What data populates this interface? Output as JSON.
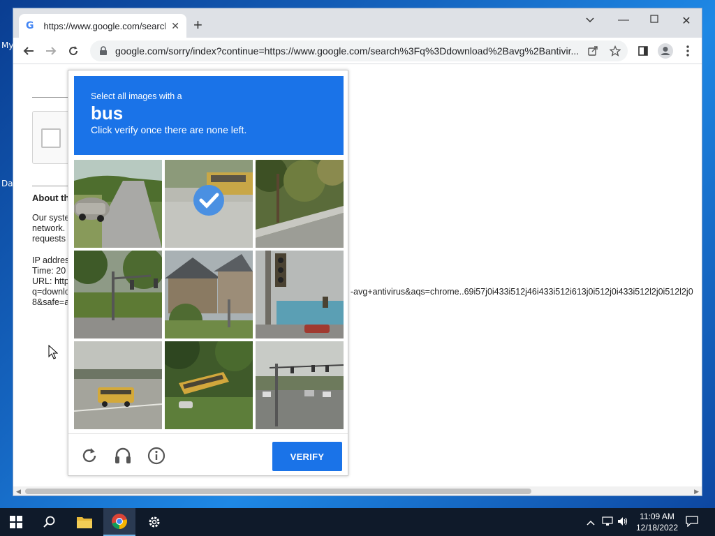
{
  "desktop": {
    "icon_labels": [
      "My",
      "Da"
    ]
  },
  "browser": {
    "tab_title": "https://www.google.com/search?q=download+avg+antivirus",
    "url": "google.com/sorry/index?continue=https://www.google.com/search%3Fq%3Ddownload%2Bavg%2Bantivir..."
  },
  "page": {
    "about_heading": "About th",
    "para_lines": [
      "Our syste",
      "network.",
      "requests"
    ],
    "ip_line": "IP addres",
    "time_line": "Time: 20",
    "url_line": "URL: http",
    "q_line": "q=downlo",
    "safe_line": "8&safe=a",
    "url_overflow": "-avg+antivirus&aqs=chrome..69i57j0i433i512j46i433i512i613j0i512j0i433i512l2j0i512l2j0"
  },
  "captcha": {
    "instruction": "Select all images with a",
    "target": "bus",
    "subtext": "Click verify once there are none left.",
    "verify_label": "VERIFY",
    "tiles": [
      {
        "subject": "road with car",
        "selected": false
      },
      {
        "subject": "bus on road",
        "selected": true
      },
      {
        "subject": "trees and guardrail",
        "selected": false
      },
      {
        "subject": "traffic light at field",
        "selected": false
      },
      {
        "subject": "houses",
        "selected": false
      },
      {
        "subject": "traffic light by building",
        "selected": false
      },
      {
        "subject": "school bus on highway",
        "selected": false
      },
      {
        "subject": "school bus on grass",
        "selected": false
      },
      {
        "subject": "intersection with traffic lights",
        "selected": false
      }
    ]
  },
  "taskbar": {
    "time": "11:09 AM",
    "date": "12/18/2022"
  },
  "colors": {
    "accent": "#1a73e8",
    "taskbar": "#0f1a2a"
  }
}
